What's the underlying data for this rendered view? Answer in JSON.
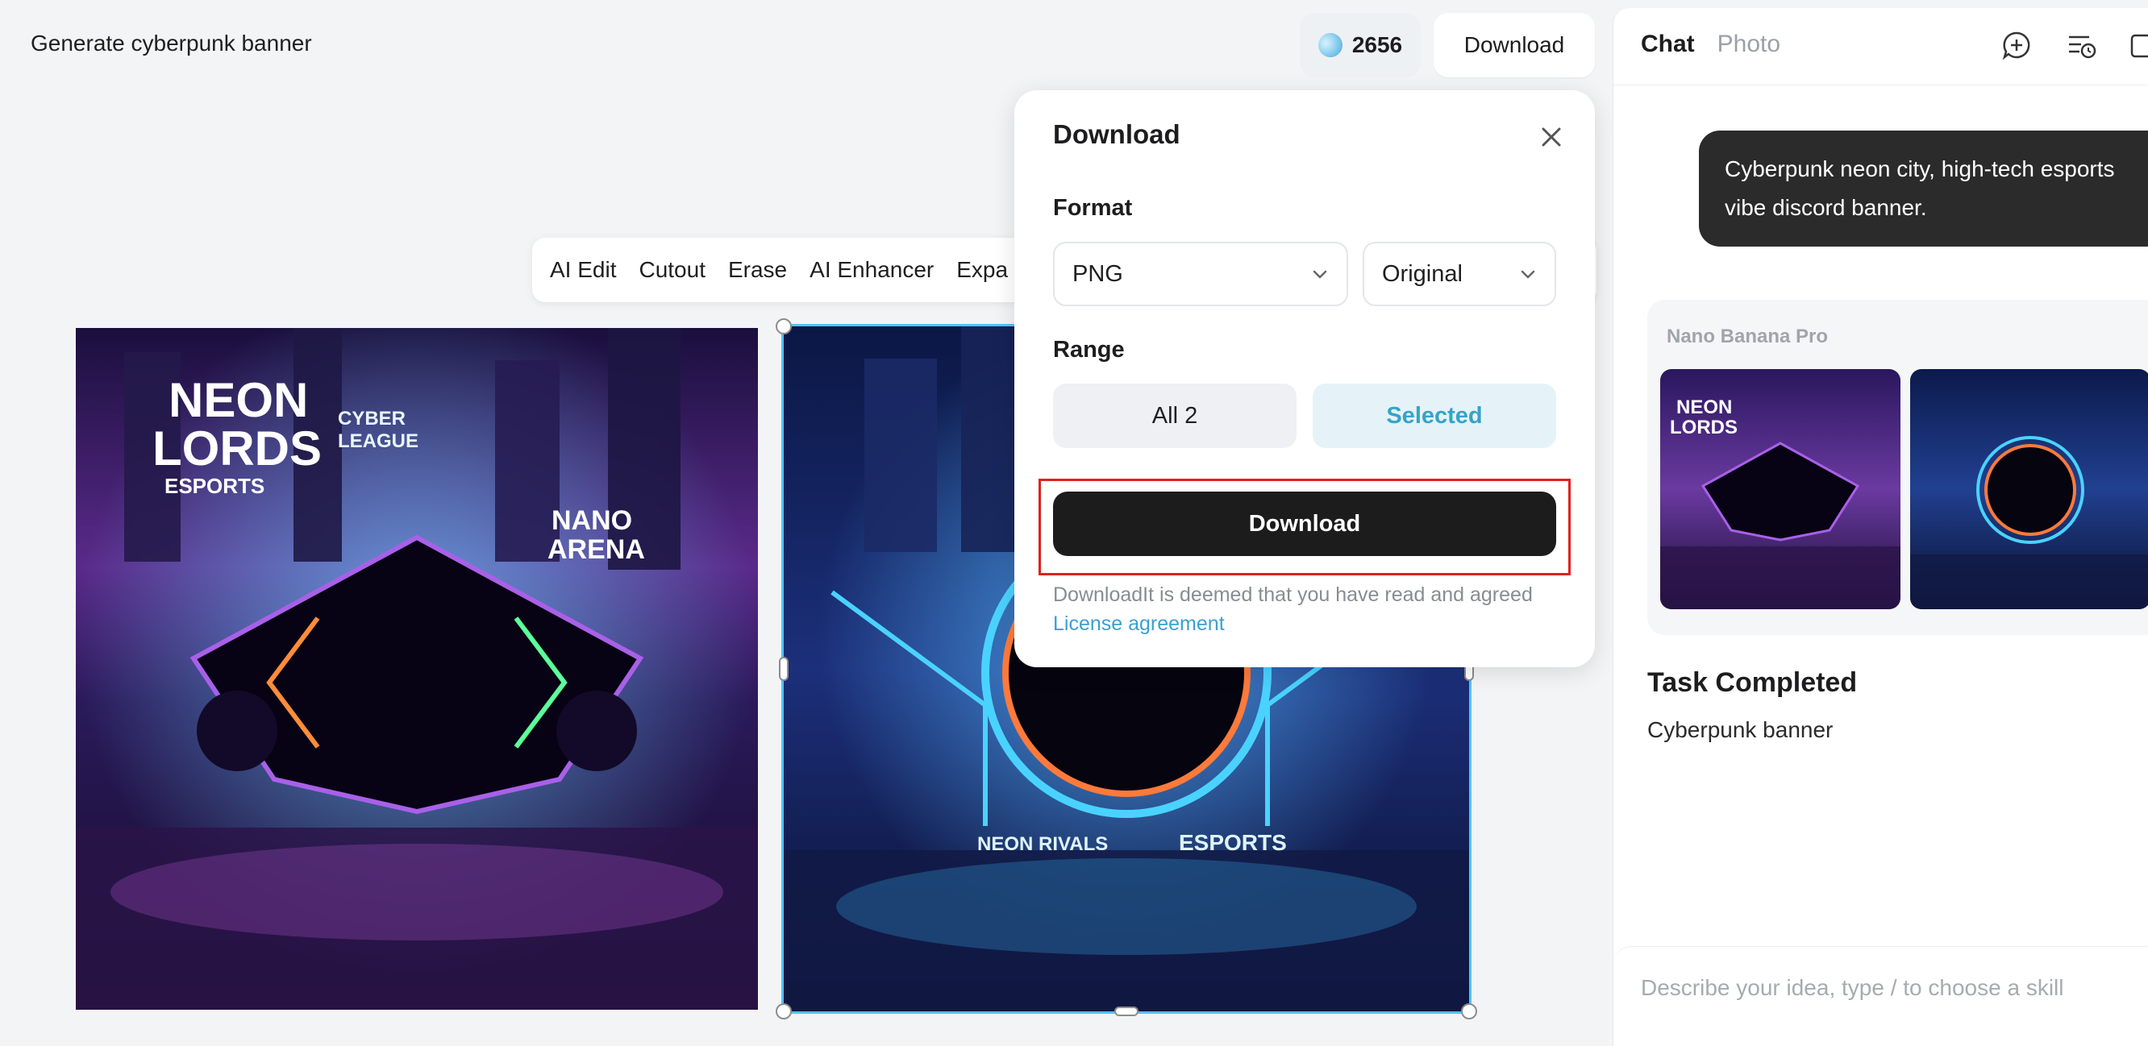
{
  "project": {
    "title": "Generate cyberpunk banner"
  },
  "header": {
    "credits": "2656",
    "download_label": "Download"
  },
  "toolbar": {
    "items": [
      "AI Edit",
      "Cutout",
      "Erase",
      "AI Enhancer",
      "Expa"
    ]
  },
  "canvas": {
    "image1_texts": [
      "NEON",
      "LORDS",
      "ESPORTS",
      "CYBER",
      "LEAGUE",
      "NANO",
      "ARENA"
    ],
    "image2_texts": [
      "NEON RIVALS",
      "ESPORTS"
    ]
  },
  "download_popup": {
    "title": "Download",
    "format_label": "Format",
    "format_value": "PNG",
    "size_value": "Original",
    "range_label": "Range",
    "range_all": "All 2",
    "range_selected": "Selected",
    "download_button": "Download",
    "terms_text": "DownloadIt is deemed that you have read and agreed",
    "license_link": "License agreement"
  },
  "panel": {
    "tabs": [
      "Chat",
      "Photo"
    ],
    "user_message": "Cyberpunk neon city, high-tech esports vibe discord banner.",
    "model_name": "Nano Banana Pro",
    "task_title": "Task Completed",
    "task_subtitle": "Cyberpunk banner",
    "input_placeholder": "Describe your idea, type / to choose a skill"
  },
  "colors": {
    "accent": "#36a3c7",
    "primary_button": "#1c1c1c",
    "highlight": "#e02020",
    "selection_outline": "#4fc3f7"
  }
}
